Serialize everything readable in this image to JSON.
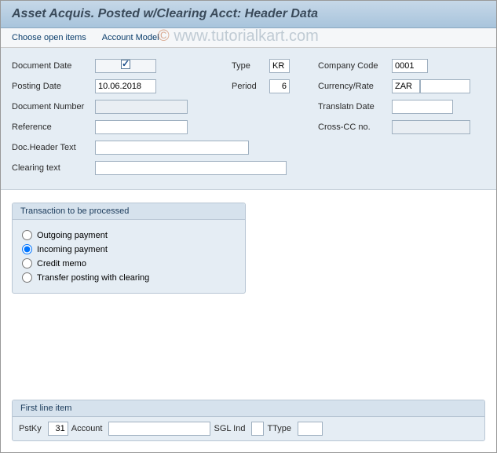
{
  "title": "Asset Acquis. Posted w/Clearing Acct: Header Data",
  "menu": {
    "choose_open_items": "Choose open items",
    "account_model": "Account Model"
  },
  "header": {
    "document_date_label": "Document Date",
    "document_date": "",
    "type_label": "Type",
    "type": "KR",
    "company_code_label": "Company Code",
    "company_code": "0001",
    "posting_date_label": "Posting Date",
    "posting_date": "10.06.2018",
    "period_label": "Period",
    "period": "6",
    "currency_rate_label": "Currency/Rate",
    "currency": "ZAR",
    "rate": "",
    "document_number_label": "Document Number",
    "document_number": "",
    "translatn_date_label": "Translatn Date",
    "translatn_date": "",
    "reference_label": "Reference",
    "reference": "",
    "cross_cc_label": "Cross-CC no.",
    "cross_cc": "",
    "doc_header_text_label": "Doc.Header Text",
    "doc_header_text": "",
    "clearing_text_label": "Clearing text",
    "clearing_text": ""
  },
  "transaction": {
    "title": "Transaction to be processed",
    "options": {
      "outgoing": "Outgoing payment",
      "incoming": "Incoming payment",
      "credit": "Credit memo",
      "transfer": "Transfer posting with clearing"
    },
    "selected": "incoming"
  },
  "first_line": {
    "title": "First line item",
    "pstky_label": "PstKy",
    "pstky": "31",
    "account_label": "Account",
    "account": "",
    "sgl_ind_label": "SGL Ind",
    "sgl_ind": "",
    "ttype_label": "TType",
    "ttype": ""
  },
  "watermark": {
    "copy": "©",
    "text": "www.tutorialkart.com"
  }
}
